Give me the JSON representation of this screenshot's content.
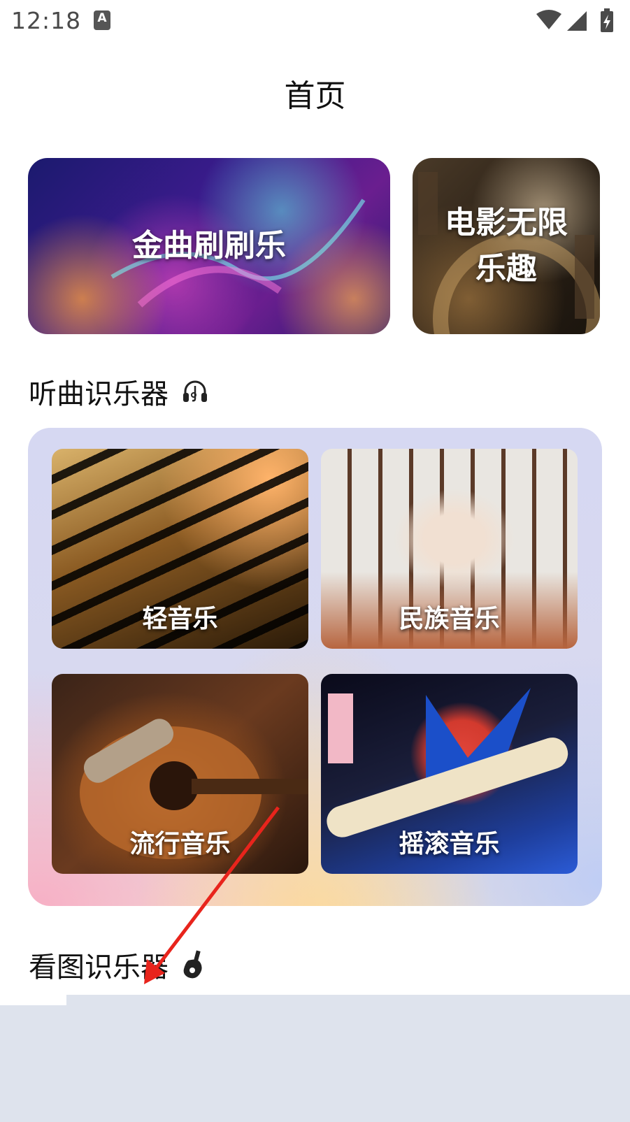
{
  "status_bar": {
    "time": "12:18",
    "notification_icon": "text-input-icon",
    "wifi_icon": "wifi-icon",
    "signal_icon": "signal-icon",
    "battery_icon": "battery-charging-icon"
  },
  "page": {
    "title": "首页"
  },
  "banners": [
    {
      "label": "金曲刷刷乐"
    },
    {
      "label_line1": "电影无限",
      "label_line2": "乐趣"
    }
  ],
  "sections": {
    "listen": {
      "title": "听曲识乐器",
      "icon": "headphones-icon"
    },
    "image": {
      "title": "看图识乐器",
      "icon": "guitar-icon"
    }
  },
  "categories": [
    {
      "label": "轻音乐"
    },
    {
      "label": "民族音乐"
    },
    {
      "label": "流行音乐"
    },
    {
      "label": "摇滚音乐"
    }
  ],
  "colors": {
    "panel_bg": "#d6d8f2",
    "arrow": "#e8241c",
    "overlay": "#dee3ed"
  }
}
